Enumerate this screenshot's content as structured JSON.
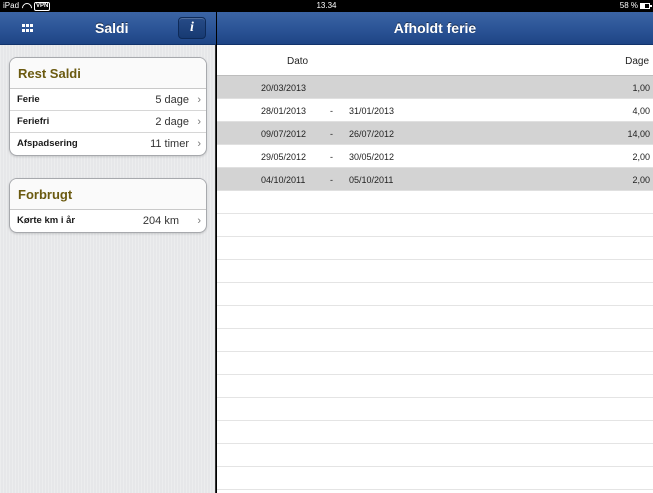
{
  "status_bar": {
    "device": "iPad",
    "vpn": "VPN",
    "time": "13.34",
    "battery": "58 %"
  },
  "master": {
    "title": "Saldi",
    "info_label": "i",
    "rest_saldi": {
      "header": "Rest Saldi",
      "items": [
        {
          "label": "Ferie",
          "value": "5 dage"
        },
        {
          "label": "Feriefri",
          "value": "2 dage"
        },
        {
          "label": "Afspadsering",
          "value": "11 timer"
        }
      ]
    },
    "forbrugt": {
      "header": "Forbrugt",
      "items": [
        {
          "label": "Kørte km i år",
          "value": "204 km"
        }
      ]
    }
  },
  "detail": {
    "title": "Afholdt ferie",
    "columns": {
      "date": "Dato",
      "days": "Dage"
    },
    "rows": [
      {
        "from": "20/03/2013",
        "dash": "",
        "to": "",
        "days": "1,00"
      },
      {
        "from": "28/01/2013",
        "dash": "-",
        "to": "31/01/2013",
        "days": "4,00"
      },
      {
        "from": "09/07/2012",
        "dash": "-",
        "to": "26/07/2012",
        "days": "14,00"
      },
      {
        "from": "29/05/2012",
        "dash": "-",
        "to": "30/05/2012",
        "days": "2,00"
      },
      {
        "from": "04/10/2011",
        "dash": "-",
        "to": "05/10/2011",
        "days": "2,00"
      }
    ]
  },
  "icons": {
    "wifi": "wifi-icon",
    "battery": "battery-icon",
    "menu": "grid-menu-icon",
    "info": "info-icon",
    "chevron": "chevron-right-icon"
  },
  "colors": {
    "navbar": "#2c5597",
    "section_header": "#6b5a10",
    "shaded_row": "#d3d3d3"
  }
}
